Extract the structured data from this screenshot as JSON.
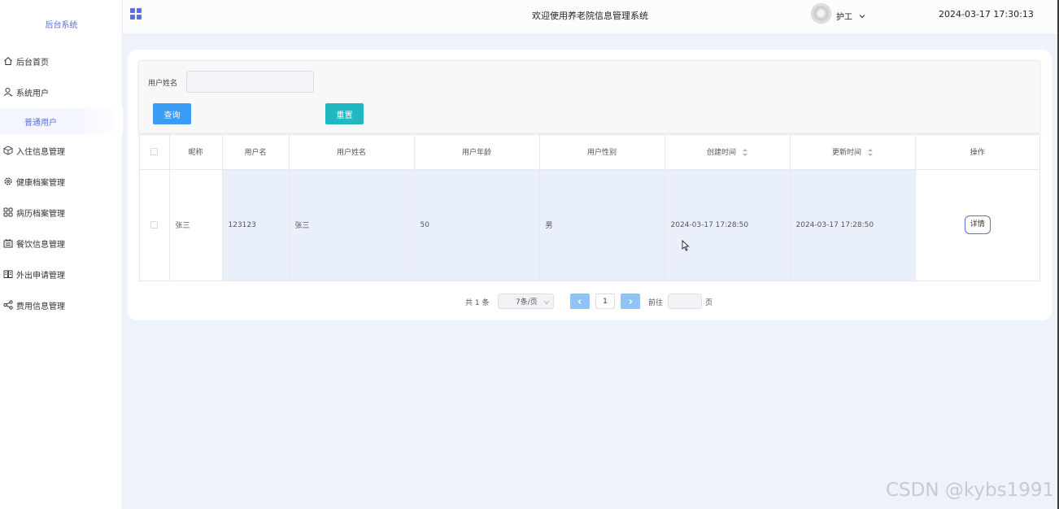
{
  "sidebar": {
    "brand": "后台系统",
    "items": [
      {
        "label": "后台首页",
        "icon": "home-icon"
      },
      {
        "label": "系统用户",
        "icon": "user-icon"
      },
      {
        "label": "入住信息管理",
        "icon": "cube-icon"
      },
      {
        "label": "健康档案管理",
        "icon": "gear-icon"
      },
      {
        "label": "病历档案管理",
        "icon": "grid-icon"
      },
      {
        "label": "餐饮信息管理",
        "icon": "menu-board-icon"
      },
      {
        "label": "外出申请管理",
        "icon": "book-icon"
      },
      {
        "label": "费用信息管理",
        "icon": "share-icon"
      }
    ],
    "sub_item": "普通用户",
    "accent": "#5b6fd6"
  },
  "header": {
    "title": "欢迎使用养老院信息管理系统",
    "role": "护工",
    "datetime": "2024-03-17 17:30:13"
  },
  "search": {
    "label": "用户姓名",
    "value": "",
    "query_label": "查询",
    "reset_label": "重置",
    "query_color": "#3a9cf4",
    "reset_color": "#21b8c2"
  },
  "table": {
    "columns": [
      "昵称",
      "用户名",
      "用户姓名",
      "用户年龄",
      "用户性别",
      "创建时间",
      "更新时间",
      "操作"
    ],
    "rows": [
      {
        "nickname": "张三",
        "username": "123123",
        "realname": "张三",
        "age": "50",
        "gender": "男",
        "created": "2024-03-17 17:28:50",
        "updated": "2024-03-17 17:28:50",
        "action": "详情"
      }
    ]
  },
  "pagination": {
    "total": "共 1 条",
    "page_size": "7条/页",
    "current_page": "1",
    "goto_label": "前往",
    "page_suffix": "页"
  },
  "watermark": "CSDN @kybs1991"
}
